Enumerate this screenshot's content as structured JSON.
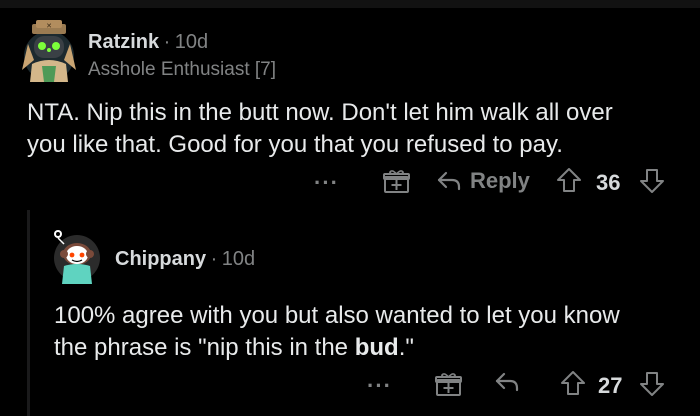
{
  "comments": [
    {
      "author": "Ratzink",
      "separator": "·",
      "age": "10d",
      "flair": "Asshole Enthusiast [7]",
      "body_line1": "NTA. Nip this in the butt now. Don't let him walk all over",
      "body_line2": "you like that. Good for you that you refused to pay.",
      "more_label": "···",
      "reply_label": "Reply",
      "score": "36",
      "icons": [
        "more-icon",
        "award-icon",
        "reply-icon",
        "upvote-icon",
        "downvote-icon"
      ]
    },
    {
      "author": "Chippany",
      "separator": "·",
      "age": "10d",
      "body_line1": "100% agree with you but also wanted to let you know",
      "body_line2_pre": "the phrase is \"nip this in the ",
      "body_line2_bold": "bud",
      "body_line2_post": ".\"",
      "more_label": "···",
      "score": "27",
      "icons": [
        "more-icon",
        "award-icon",
        "reply-icon",
        "upvote-icon",
        "downvote-icon"
      ]
    }
  ],
  "colors": {
    "background": "#000000",
    "text": "#d7dadc",
    "muted": "#818384",
    "thread_line": "#1a1a1b"
  }
}
